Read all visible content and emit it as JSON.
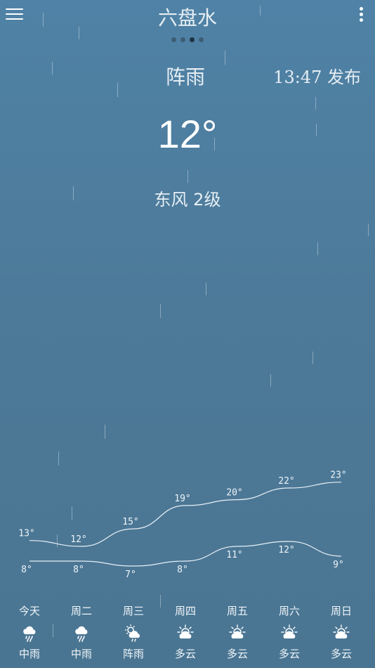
{
  "header": {
    "city": "六盘水",
    "page_count": 4,
    "active_page_index": 2,
    "menu_icon": "hamburger-menu-icon",
    "more_icon": "vertical-dots-icon"
  },
  "current": {
    "condition": "阵雨",
    "publish_time": "13:47 发布",
    "temperature": "12°",
    "wind": "东风 2级"
  },
  "forecast": [
    {
      "day": "今天",
      "high": "13°",
      "low": "8°",
      "desc": "中雨",
      "icon": "moderate-rain-icon"
    },
    {
      "day": "周二",
      "high": "12°",
      "low": "8°",
      "desc": "中雨",
      "icon": "moderate-rain-icon"
    },
    {
      "day": "周三",
      "high": "15°",
      "low": "7°",
      "desc": "阵雨",
      "icon": "shower-icon"
    },
    {
      "day": "周四",
      "high": "19°",
      "low": "8°",
      "desc": "多云",
      "icon": "partly-cloudy-icon"
    },
    {
      "day": "周五",
      "high": "20°",
      "low": "11°",
      "desc": "多云",
      "icon": "partly-cloudy-icon"
    },
    {
      "day": "周六",
      "high": "22°",
      "low": "12°",
      "desc": "多云",
      "icon": "partly-cloudy-icon"
    },
    {
      "day": "周日",
      "high": "23°",
      "low": "9°",
      "desc": "多云",
      "icon": "partly-cloudy-icon"
    }
  ],
  "colors": {
    "background_top": "#4f82a6",
    "background_bottom": "#4a7592",
    "text": "#eef4f8"
  }
}
